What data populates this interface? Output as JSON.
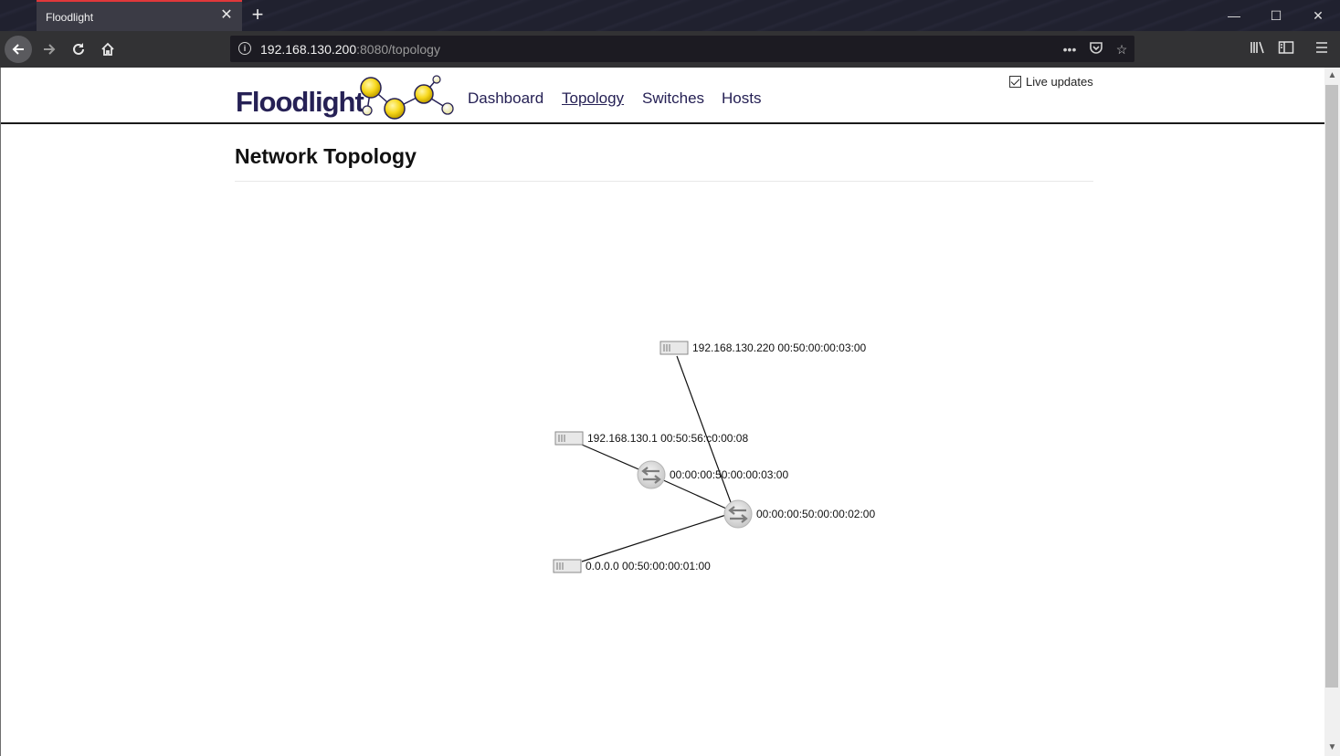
{
  "browser": {
    "tab_title": "Floodlight",
    "url_host": "192.168.130.200",
    "url_rest": ":8080/topology"
  },
  "site": {
    "logo_text": "Floodlight",
    "nav": [
      {
        "label": "Dashboard",
        "active": false
      },
      {
        "label": "Topology",
        "active": true
      },
      {
        "label": "Switches",
        "active": false
      },
      {
        "label": "Hosts",
        "active": false
      }
    ],
    "live_updates_label": "Live updates",
    "live_updates_checked": true,
    "page_title": "Network Topology"
  },
  "topology": {
    "switches": [
      {
        "id": "sw3",
        "dpid": "00:00:00:50:00:00:03:00"
      },
      {
        "id": "sw2",
        "dpid": "00:00:00:50:00:00:02:00"
      }
    ],
    "hosts": [
      {
        "id": "h1",
        "label": "192.168.130.220 00:50:00:00:03:00"
      },
      {
        "id": "h2",
        "label": "192.168.130.1 00:50:56:c0:00:08"
      },
      {
        "id": "h3",
        "label": "0.0.0.0 00:50:00:00:01:00"
      }
    ],
    "links": [
      {
        "from": "h1",
        "to": "sw2"
      },
      {
        "from": "h2",
        "to": "sw3"
      },
      {
        "from": "sw3",
        "to": "sw2"
      },
      {
        "from": "h3",
        "to": "sw2"
      }
    ]
  }
}
